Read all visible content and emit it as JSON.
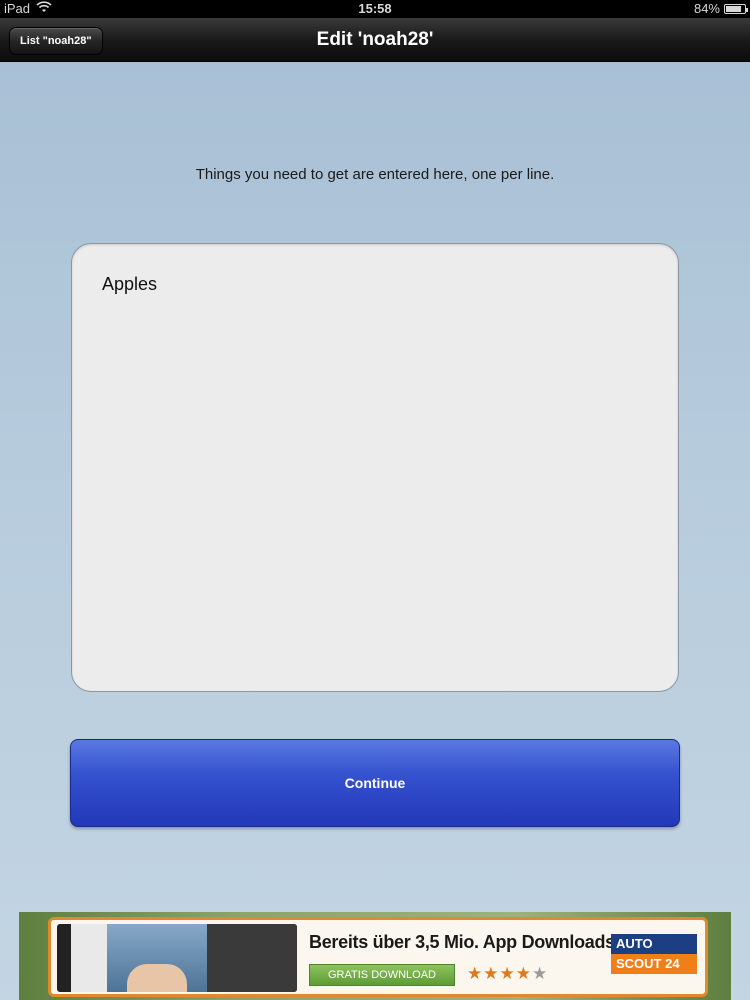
{
  "status_bar": {
    "device": "iPad",
    "time": "15:58",
    "battery_text": "84%",
    "battery_level": 0.84
  },
  "nav": {
    "back_label": "List \"noah28\"",
    "title": "Edit 'noah28'"
  },
  "main": {
    "instructions": "Things you need to get are entered here, one per line.",
    "list_text": "Apples",
    "continue_label": "Continue"
  },
  "ad": {
    "headline": "Bereits über 3,5 Mio. App Downloads",
    "cta_label": "GRATIS DOWNLOAD",
    "rating": 4,
    "rating_max": 5,
    "logo_line1": "AUTO",
    "logo_line2": "SCOUT 24"
  },
  "colors": {
    "accent_button": "#3552cf",
    "nav_bar": "#1a1a1a",
    "ad_border": "#e08a2b"
  }
}
